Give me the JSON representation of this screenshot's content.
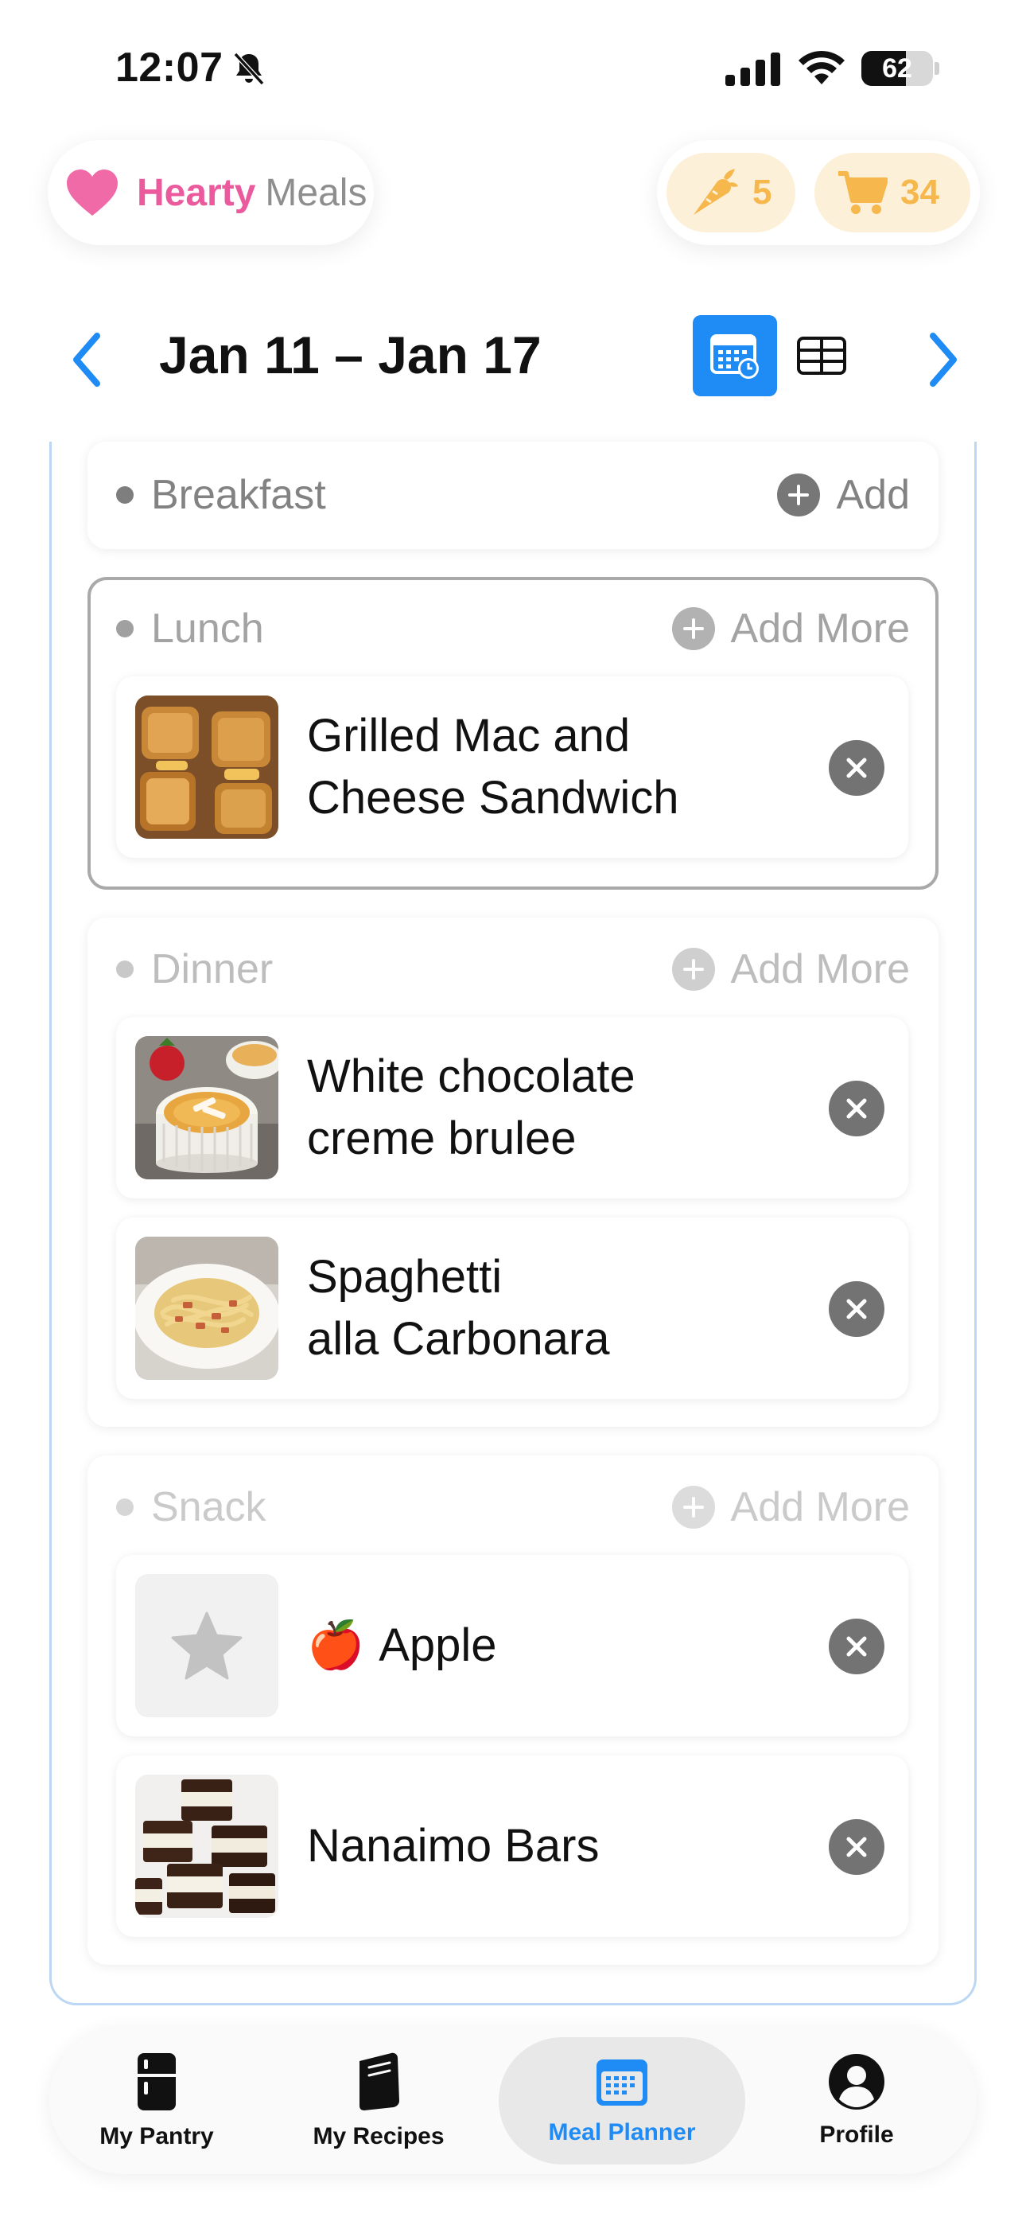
{
  "status_bar": {
    "time": "12:07",
    "battery": "62",
    "battery_level": 0.62
  },
  "brand": {
    "name_part1": "Hearty",
    "name_part2": "Meals"
  },
  "counters": {
    "pantry_count": "5",
    "cart_count": "34"
  },
  "week_nav": {
    "title": "Jan 11 – Jan 17"
  },
  "meals": {
    "breakfast": {
      "title": "Breakfast",
      "add_label": "Add"
    },
    "lunch": {
      "title": "Lunch",
      "add_label": "Add More",
      "items": [
        {
          "name": "Grilled Mac and\nCheese Sandwich"
        }
      ]
    },
    "dinner": {
      "title": "Dinner",
      "add_label": "Add More",
      "items": [
        {
          "name": "White chocolate\ncreme brulee"
        },
        {
          "name": "Spaghetti\nalla Carbonara"
        }
      ]
    },
    "snack": {
      "title": "Snack",
      "add_label": "Add More",
      "items": [
        {
          "name": "Apple",
          "emoji": "🍎"
        },
        {
          "name": "Nanaimo Bars"
        }
      ]
    }
  },
  "tabs": [
    {
      "label": "My Pantry",
      "icon": "fridge-icon"
    },
    {
      "label": "My Recipes",
      "icon": "recipe-book-icon"
    },
    {
      "label": "Meal Planner",
      "icon": "calendar-icon",
      "active": true
    },
    {
      "label": "Profile",
      "icon": "person-icon"
    }
  ],
  "colors": {
    "accent": "#1f8bf5",
    "brand_pink": "#ec5a9e",
    "counter_orange": "#f6b74c",
    "panel_border": "#bcd7f4"
  }
}
